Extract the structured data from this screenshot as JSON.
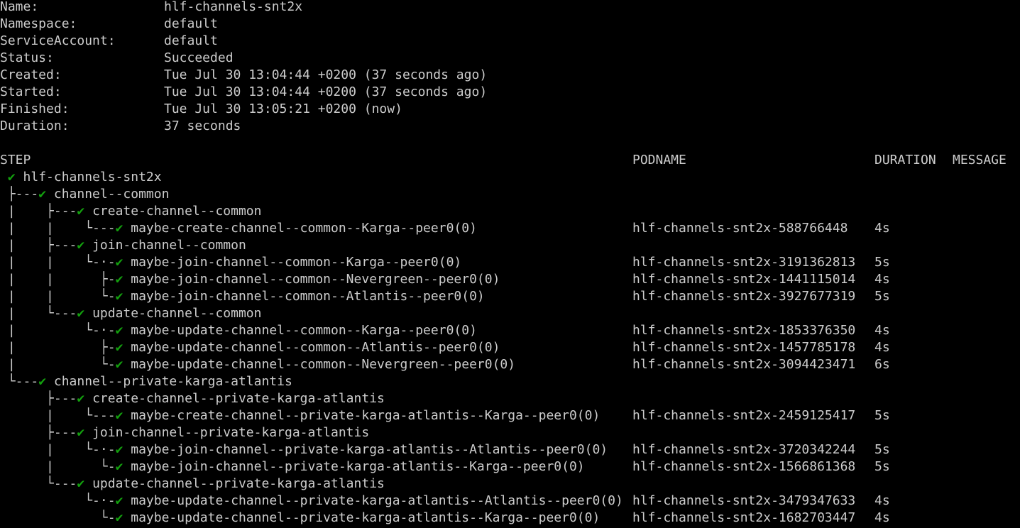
{
  "meta": [
    {
      "key": "Name:",
      "value": "hlf-channels-snt2x"
    },
    {
      "key": "Namespace:",
      "value": "default"
    },
    {
      "key": "ServiceAccount:",
      "value": "default"
    },
    {
      "key": "Status:",
      "value": "Succeeded"
    },
    {
      "key": "Created:",
      "value": "Tue Jul 30 13:04:44 +0200 (37 seconds ago)"
    },
    {
      "key": "Started:",
      "value": "Tue Jul 30 13:04:44 +0200 (37 seconds ago)"
    },
    {
      "key": "Finished:",
      "value": "Tue Jul 30 13:05:21 +0200 (now)"
    },
    {
      "key": "Duration:",
      "value": "37 seconds"
    }
  ],
  "headers": {
    "step": "STEP",
    "podname": "PODNAME",
    "duration": "DURATION",
    "message": "MESSAGE"
  },
  "status_icon": "✔",
  "status_icon_name": "check-icon",
  "colors": {
    "success": "#13a10e",
    "text": "#cccccc",
    "background": "#000000"
  },
  "rows": [
    {
      "prefix": " ",
      "name": "hlf-channels-snt2x",
      "pod": "",
      "dur": ""
    },
    {
      "prefix": " ├---",
      "name": "channel--common",
      "pod": "",
      "dur": ""
    },
    {
      "prefix": " |    ├---",
      "name": "create-channel--common",
      "pod": "",
      "dur": ""
    },
    {
      "prefix": " |    |    └---",
      "name": "maybe-create-channel--common--Karga--peer0(0)",
      "pod": "hlf-channels-snt2x-588766448",
      "dur": "4s"
    },
    {
      "prefix": " |    ├---",
      "name": "join-channel--common",
      "pod": "",
      "dur": ""
    },
    {
      "prefix": " |    |    └-·-",
      "name": "maybe-join-channel--common--Karga--peer0(0)",
      "pod": "hlf-channels-snt2x-3191362813",
      "dur": "5s"
    },
    {
      "prefix": " |    |      ├-",
      "name": "maybe-join-channel--common--Nevergreen--peer0(0)",
      "pod": "hlf-channels-snt2x-1441115014",
      "dur": "4s"
    },
    {
      "prefix": " |    |      └-",
      "name": "maybe-join-channel--common--Atlantis--peer0(0)",
      "pod": "hlf-channels-snt2x-3927677319",
      "dur": "5s"
    },
    {
      "prefix": " |    └---",
      "name": "update-channel--common",
      "pod": "",
      "dur": ""
    },
    {
      "prefix": " |         └-·-",
      "name": "maybe-update-channel--common--Karga--peer0(0)",
      "pod": "hlf-channels-snt2x-1853376350",
      "dur": "4s"
    },
    {
      "prefix": " |           ├-",
      "name": "maybe-update-channel--common--Atlantis--peer0(0)",
      "pod": "hlf-channels-snt2x-1457785178",
      "dur": "4s"
    },
    {
      "prefix": " |           └-",
      "name": "maybe-update-channel--common--Nevergreen--peer0(0)",
      "pod": "hlf-channels-snt2x-3094423471",
      "dur": "6s"
    },
    {
      "prefix": " └---",
      "name": "channel--private-karga-atlantis",
      "pod": "",
      "dur": ""
    },
    {
      "prefix": "      ├---",
      "name": "create-channel--private-karga-atlantis",
      "pod": "",
      "dur": ""
    },
    {
      "prefix": "      |    └---",
      "name": "maybe-create-channel--private-karga-atlantis--Karga--peer0(0)",
      "pod": "hlf-channels-snt2x-2459125417",
      "dur": "5s"
    },
    {
      "prefix": "      ├---",
      "name": "join-channel--private-karga-atlantis",
      "pod": "",
      "dur": ""
    },
    {
      "prefix": "      |    └-·-",
      "name": "maybe-join-channel--private-karga-atlantis--Atlantis--peer0(0)",
      "pod": "hlf-channels-snt2x-3720342244",
      "dur": "5s"
    },
    {
      "prefix": "      |      └-",
      "name": "maybe-join-channel--private-karga-atlantis--Karga--peer0(0)",
      "pod": "hlf-channels-snt2x-1566861368",
      "dur": "5s"
    },
    {
      "prefix": "      └---",
      "name": "update-channel--private-karga-atlantis",
      "pod": "",
      "dur": ""
    },
    {
      "prefix": "           └-·-",
      "name": "maybe-update-channel--private-karga-atlantis--Atlantis--peer0(0)",
      "pod": "hlf-channels-snt2x-3479347633",
      "dur": "4s"
    },
    {
      "prefix": "             └-",
      "name": "maybe-update-channel--private-karga-atlantis--Karga--peer0(0)",
      "pod": "hlf-channels-snt2x-1682703447",
      "dur": "4s"
    }
  ]
}
